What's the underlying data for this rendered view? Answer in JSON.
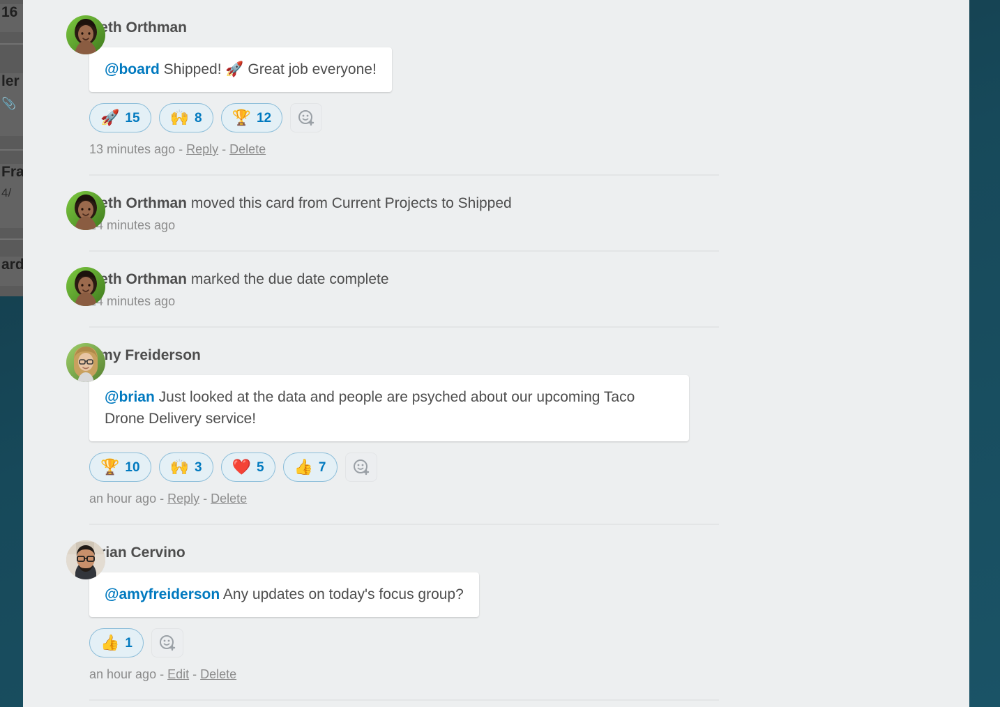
{
  "background": {
    "board_color": "#17495a",
    "panel_color": "#edeff0"
  },
  "backdrop_cards": [
    {
      "title": "16",
      "meta": ""
    },
    {
      "title": "ler",
      "meta": ""
    },
    {
      "title": "Fra",
      "meta": "4/"
    },
    {
      "title": "ard",
      "meta": ""
    }
  ],
  "feed": {
    "entries": [
      {
        "type": "comment",
        "author": "Beth Orthman",
        "avatar": "beth-orthman-avatar",
        "mention": "@board",
        "text": " Shipped! 🚀 Great job everyone!",
        "reactions": [
          {
            "emoji": "🚀",
            "name": "rocket",
            "count": "15"
          },
          {
            "emoji": "🙌",
            "name": "raised-hands",
            "count": "8"
          },
          {
            "emoji": "🏆",
            "name": "trophy",
            "count": "12"
          }
        ],
        "add_reaction_label": "add-reaction",
        "timestamp": "13 minutes ago",
        "actions": [
          "Reply",
          "Delete"
        ]
      },
      {
        "type": "activity",
        "author": "Beth Orthman",
        "avatar": "beth-orthman-avatar",
        "action": " moved this card from Current Projects to Shipped",
        "timestamp": "14 minutes ago"
      },
      {
        "type": "activity",
        "author": "Beth Orthman",
        "avatar": "beth-orthman-avatar",
        "action": " marked the due date complete",
        "timestamp": "14 minutes ago"
      },
      {
        "type": "comment",
        "author": "Amy Freiderson",
        "avatar": "amy-freiderson-avatar",
        "mention": "@brian",
        "text": " Just looked at the data and people are psyched about our upcoming Taco Drone Delivery service!",
        "reactions": [
          {
            "emoji": "🏆",
            "name": "trophy",
            "count": "10"
          },
          {
            "emoji": "🙌",
            "name": "raised-hands",
            "count": "3"
          },
          {
            "emoji": "❤️",
            "name": "heart",
            "count": "5"
          },
          {
            "emoji": "👍",
            "name": "thumbs-up",
            "count": "7"
          }
        ],
        "add_reaction_label": "add-reaction",
        "timestamp": "an hour ago",
        "actions": [
          "Reply",
          "Delete"
        ]
      },
      {
        "type": "comment",
        "author": "Brian Cervino",
        "avatar": "brian-cervino-avatar",
        "mention": "@amyfreiderson",
        "text": " Any updates on today's focus group?",
        "reactions": [
          {
            "emoji": "👍",
            "name": "thumbs-up",
            "count": "1"
          }
        ],
        "add_reaction_label": "add-reaction",
        "timestamp": "an hour ago",
        "actions": [
          "Edit",
          "Delete"
        ]
      }
    ],
    "separator": "-"
  },
  "colors": {
    "mention_blue": "#0079bf",
    "reaction_border": "#8bbdd9",
    "reaction_fill": "#e4f0f6",
    "meta_grey": "#8c8c8c"
  }
}
